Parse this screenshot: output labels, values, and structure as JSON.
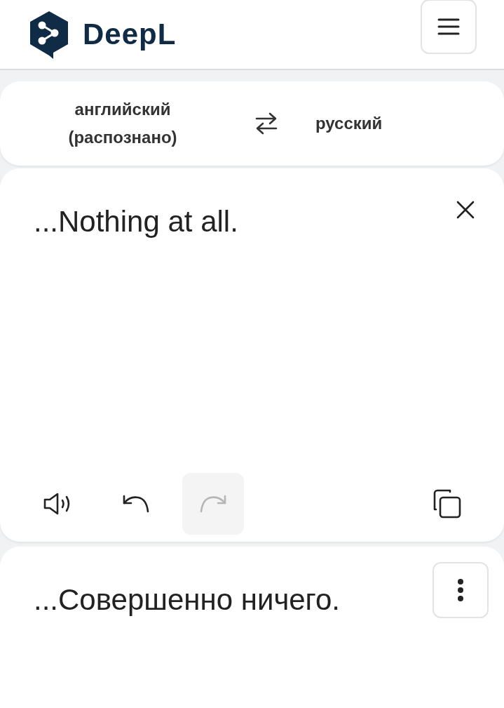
{
  "header": {
    "logo_text": "DeepL"
  },
  "languages": {
    "source": "английский (распознано)",
    "target": "русский"
  },
  "source": {
    "text": "...Nothing at all."
  },
  "toolbar": [
    {
      "kind": "speaker",
      "disabled": false
    },
    {
      "kind": "undo",
      "disabled": false
    },
    {
      "kind": "redo",
      "disabled": true
    },
    {
      "kind": "copy",
      "disabled": false
    }
  ],
  "target": {
    "text": "...Совершенно ничего."
  }
}
